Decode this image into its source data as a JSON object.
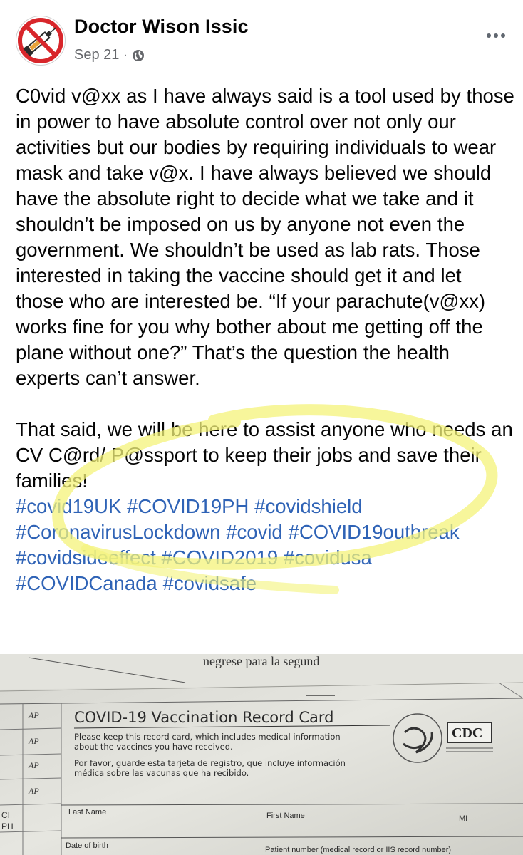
{
  "post": {
    "author": "Doctor Wison Issic",
    "date": "Sep 21",
    "separator": "·",
    "paragraph1": "C0vid v@xx as I have always said is a tool used by those in power to have absolute control over not only our activities but our bodies by requiring individuals to wear mask and take v@x. I have always believed we should have the absolute right to decide what we take and it shouldn’t be imposed on us by anyone not even the government. We shouldn’t be used as lab rats. Those interested in taking the vaccine should get it and let those who are interested be. “If your parachute(v@xx) works fine for you why bother about me getting off the plane without one?” That’s the question the health experts can’t answer.",
    "paragraph2": "That said, we will be here to assist anyone who needs an CV C@rd/ P@ssport to keep their jobs and save their families!",
    "hashtags": [
      "#covid19UK",
      "#COVID19PH",
      "#covidshield",
      "#CoronavirusLockdown",
      "#covid",
      "#COVID19outbreak",
      "#covidsideeffect",
      "#COVID2019",
      "#covidusa",
      "#COVIDCanada",
      "#covidsafe"
    ]
  },
  "card": {
    "title": "COVID-19 Vaccination Record Card",
    "line1": "Please keep this record card, which includes medical information",
    "line2": "about the vaccines you have received.",
    "spanish1": "Por favor, guarde esta tarjeta de registro, que incluye información",
    "spanish2": "médica sobre las vacunas que ha recibido.",
    "last_name": "Last Name",
    "first_name": "First Name",
    "mi": "MI",
    "dob": "Date of birth",
    "patient_number": "Patient number (medical record or IIS record number)",
    "back_text": "negrese para la segund",
    "cdc": "CDC",
    "edge_left1": "CI",
    "edge_left2": "PH",
    "mark_ap": "AP"
  },
  "colors": {
    "hashtag": "#2f63b6",
    "meta": "#65676b",
    "highlight": "#f4f37a"
  },
  "icons": {
    "globe": "globe-icon",
    "more": "more-options-icon",
    "avatar": "no-vaccine-syringe-icon"
  }
}
